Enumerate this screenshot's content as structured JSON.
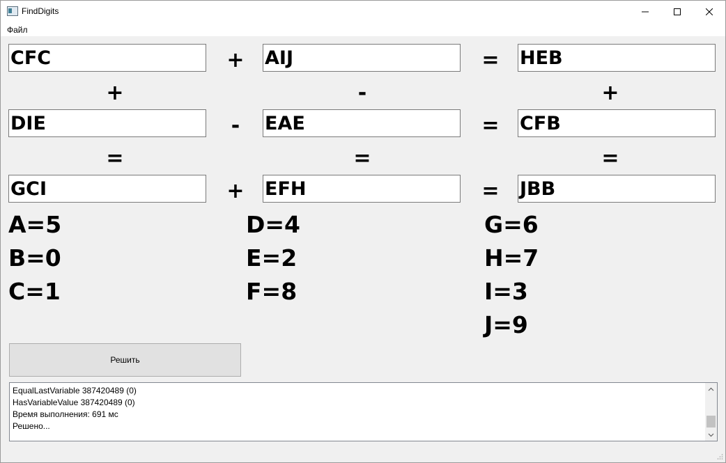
{
  "window": {
    "title": "FindDigits"
  },
  "menu": {
    "file_label": "Файл"
  },
  "puzzle": {
    "rows": [
      {
        "left": "CFC",
        "op": "+",
        "middle": "AIJ",
        "eq": "=",
        "right": "HEB"
      },
      {
        "left": "DIE",
        "op": "-",
        "middle": "EAE",
        "eq": "=",
        "right": "CFB"
      },
      {
        "left": "GCI",
        "op": "+",
        "middle": "EFH",
        "eq": "=",
        "right": "JBB"
      }
    ],
    "column_ops": [
      "+",
      "-",
      "+"
    ],
    "column_eqs": [
      "=",
      "=",
      "="
    ]
  },
  "results": {
    "col1": [
      "A=5",
      "B=0",
      "C=1"
    ],
    "col2": [
      "D=4",
      "E=2",
      "F=8"
    ],
    "col3": [
      "G=6",
      "H=7",
      "I=3",
      "J=9"
    ]
  },
  "solve_button": {
    "label": "Решить"
  },
  "log": {
    "lines": [
      "EqualLastVariable 387420489 (0)",
      "HasVariableValue 387420489 (0)",
      "Время выполнения: 691 мс",
      "Решено..."
    ]
  }
}
